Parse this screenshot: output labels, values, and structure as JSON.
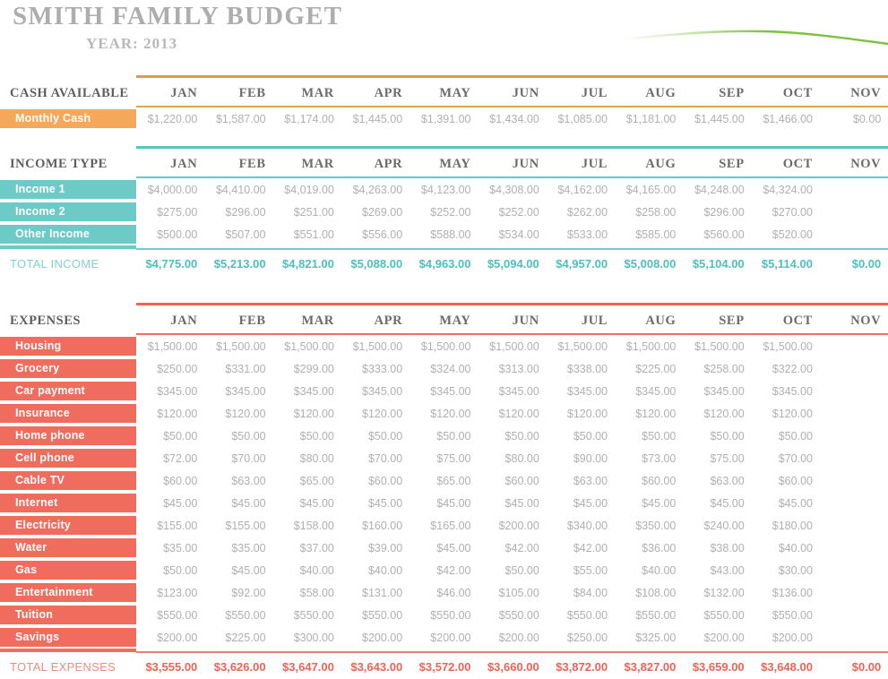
{
  "header": {
    "title": "SMITH FAMILY BUDGET",
    "year_label": "YEAR: 2013",
    "sparkline_color": "#7cc142"
  },
  "months": [
    "JAN",
    "FEB",
    "MAR",
    "APR",
    "MAY",
    "JUN",
    "JUL",
    "AUG",
    "SEP",
    "OCT",
    "NOV"
  ],
  "colors": {
    "cash_accent": "#dd9b45",
    "cash_chip": "#f5a75a",
    "income_accent": "#5bc4c0",
    "income_chip": "#6ecac7",
    "income_total_text": "#4cc0bd",
    "expense_accent": "#ec6557",
    "expense_chip": "#f06c5f",
    "expense_total_text": "#ef6256",
    "value_text": "#b0b0b0",
    "title_text": "#adadad"
  },
  "cash_section": {
    "section_title": "CASH AVAILABLE",
    "rows": [
      {
        "label": "Monthly Cash",
        "values": [
          "$1,220.00",
          "$1,587.00",
          "$1,174.00",
          "$1,445.00",
          "$1,391.00",
          "$1,434.00",
          "$1,085.00",
          "$1,181.00",
          "$1,445.00",
          "$1,466.00",
          "$0.00"
        ]
      }
    ]
  },
  "income_section": {
    "section_title": "INCOME TYPE",
    "rows": [
      {
        "label": "Income 1",
        "values": [
          "$4,000.00",
          "$4,410.00",
          "$4,019.00",
          "$4,263.00",
          "$4,123.00",
          "$4,308.00",
          "$4,162.00",
          "$4,165.00",
          "$4,248.00",
          "$4,324.00",
          ""
        ]
      },
      {
        "label": "Income 2",
        "values": [
          "$275.00",
          "$296.00",
          "$251.00",
          "$269.00",
          "$252.00",
          "$252.00",
          "$262.00",
          "$258.00",
          "$296.00",
          "$270.00",
          ""
        ]
      },
      {
        "label": "Other Income",
        "values": [
          "$500.00",
          "$507.00",
          "$551.00",
          "$556.00",
          "$588.00",
          "$534.00",
          "$533.00",
          "$585.00",
          "$560.00",
          "$520.00",
          ""
        ]
      }
    ],
    "total": {
      "label": "TOTAL INCOME",
      "values": [
        "$4,775.00",
        "$5,213.00",
        "$4,821.00",
        "$5,088.00",
        "$4,963.00",
        "$5,094.00",
        "$4,957.00",
        "$5,008.00",
        "$5,104.00",
        "$5,114.00",
        "$0.00"
      ]
    }
  },
  "expense_section": {
    "section_title": "EXPENSES",
    "rows": [
      {
        "label": "Housing",
        "values": [
          "$1,500.00",
          "$1,500.00",
          "$1,500.00",
          "$1,500.00",
          "$1,500.00",
          "$1,500.00",
          "$1,500.00",
          "$1,500.00",
          "$1,500.00",
          "$1,500.00",
          ""
        ]
      },
      {
        "label": "Grocery",
        "values": [
          "$250.00",
          "$331.00",
          "$299.00",
          "$333.00",
          "$324.00",
          "$313.00",
          "$338.00",
          "$225.00",
          "$258.00",
          "$322.00",
          ""
        ]
      },
      {
        "label": "Car payment",
        "values": [
          "$345.00",
          "$345.00",
          "$345.00",
          "$345.00",
          "$345.00",
          "$345.00",
          "$345.00",
          "$345.00",
          "$345.00",
          "$345.00",
          ""
        ]
      },
      {
        "label": "Insurance",
        "values": [
          "$120.00",
          "$120.00",
          "$120.00",
          "$120.00",
          "$120.00",
          "$120.00",
          "$120.00",
          "$120.00",
          "$120.00",
          "$120.00",
          ""
        ]
      },
      {
        "label": "Home phone",
        "values": [
          "$50.00",
          "$50.00",
          "$50.00",
          "$50.00",
          "$50.00",
          "$50.00",
          "$50.00",
          "$50.00",
          "$50.00",
          "$50.00",
          ""
        ]
      },
      {
        "label": "Cell phone",
        "values": [
          "$72.00",
          "$70.00",
          "$80.00",
          "$70.00",
          "$75.00",
          "$80.00",
          "$90.00",
          "$73.00",
          "$75.00",
          "$70.00",
          ""
        ]
      },
      {
        "label": "Cable TV",
        "values": [
          "$60.00",
          "$63.00",
          "$65.00",
          "$60.00",
          "$65.00",
          "$60.00",
          "$63.00",
          "$60.00",
          "$63.00",
          "$60.00",
          ""
        ]
      },
      {
        "label": "Internet",
        "values": [
          "$45.00",
          "$45.00",
          "$45.00",
          "$45.00",
          "$45.00",
          "$45.00",
          "$45.00",
          "$45.00",
          "$45.00",
          "$45.00",
          ""
        ]
      },
      {
        "label": "Electricity",
        "values": [
          "$155.00",
          "$155.00",
          "$158.00",
          "$160.00",
          "$165.00",
          "$200.00",
          "$340.00",
          "$350.00",
          "$240.00",
          "$180.00",
          ""
        ]
      },
      {
        "label": "Water",
        "values": [
          "$35.00",
          "$35.00",
          "$37.00",
          "$39.00",
          "$45.00",
          "$42.00",
          "$42.00",
          "$36.00",
          "$38.00",
          "$40.00",
          ""
        ]
      },
      {
        "label": "Gas",
        "values": [
          "$50.00",
          "$45.00",
          "$40.00",
          "$40.00",
          "$42.00",
          "$50.00",
          "$55.00",
          "$40.00",
          "$43.00",
          "$30.00",
          ""
        ]
      },
      {
        "label": "Entertainment",
        "values": [
          "$123.00",
          "$92.00",
          "$58.00",
          "$131.00",
          "$46.00",
          "$105.00",
          "$84.00",
          "$108.00",
          "$132.00",
          "$136.00",
          ""
        ]
      },
      {
        "label": "Tuition",
        "values": [
          "$550.00",
          "$550.00",
          "$550.00",
          "$550.00",
          "$550.00",
          "$550.00",
          "$550.00",
          "$550.00",
          "$550.00",
          "$550.00",
          ""
        ]
      },
      {
        "label": "Savings",
        "values": [
          "$200.00",
          "$225.00",
          "$300.00",
          "$200.00",
          "$200.00",
          "$200.00",
          "$250.00",
          "$325.00",
          "$200.00",
          "$200.00",
          ""
        ]
      }
    ],
    "total": {
      "label": "TOTAL EXPENSES",
      "values": [
        "$3,555.00",
        "$3,626.00",
        "$3,647.00",
        "$3,643.00",
        "$3,572.00",
        "$3,660.00",
        "$3,872.00",
        "$3,827.00",
        "$3,659.00",
        "$3,648.00",
        "$0.00"
      ]
    }
  }
}
